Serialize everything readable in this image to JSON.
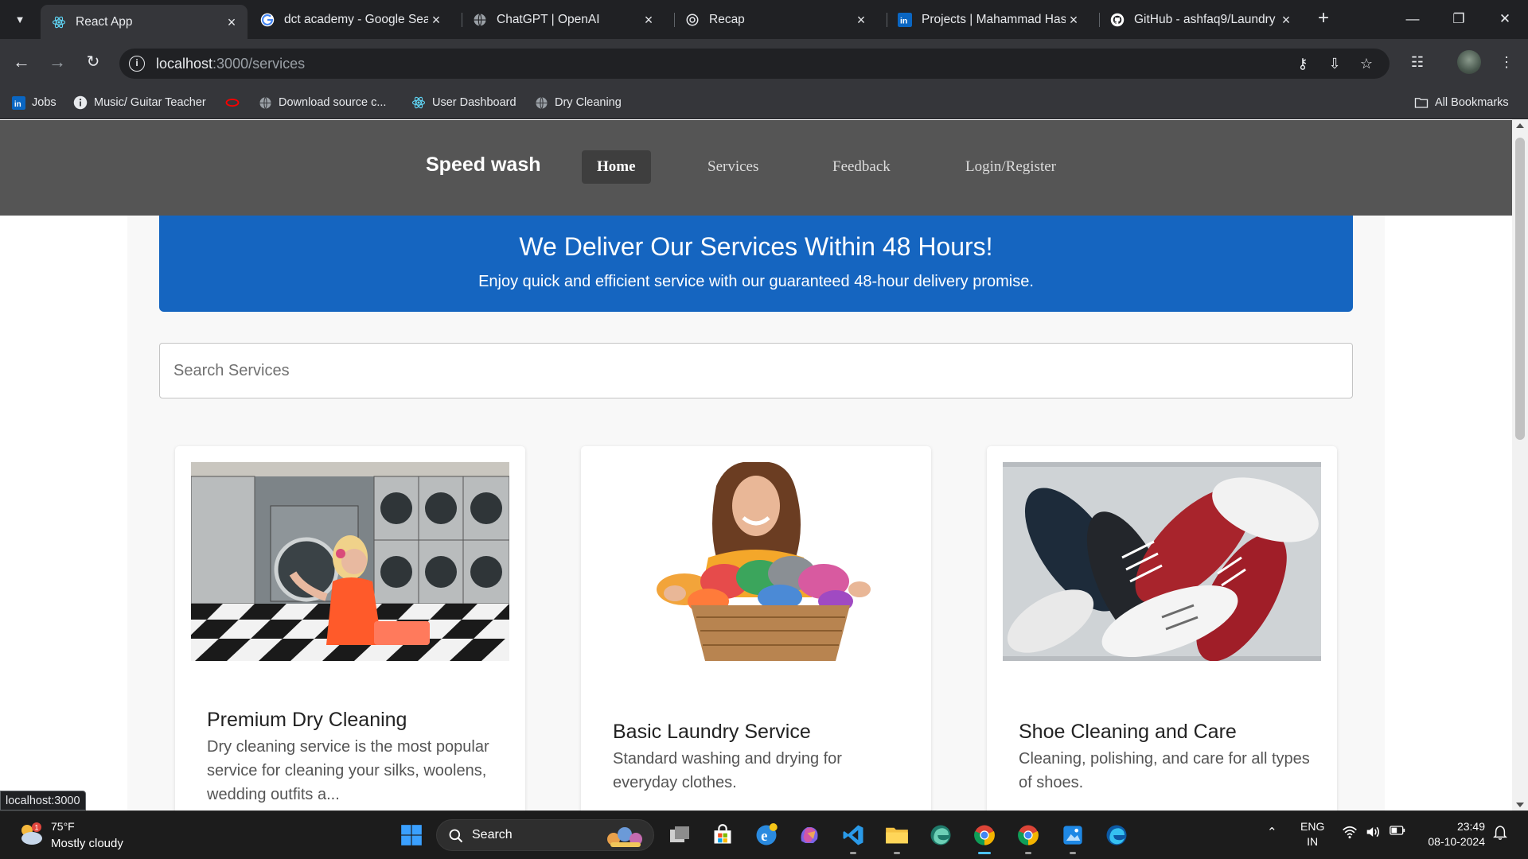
{
  "browser": {
    "tabs": [
      {
        "title": "React App",
        "icon": "react-icon",
        "active": true
      },
      {
        "title": "dct academy - Google Sea",
        "icon": "google-icon",
        "active": false
      },
      {
        "title": "ChatGPT | OpenAI",
        "icon": "globe-icon",
        "active": false
      },
      {
        "title": "Recap",
        "icon": "openai-icon",
        "active": false
      },
      {
        "title": "Projects | Mahammad Has",
        "icon": "linkedin-icon",
        "active": false
      },
      {
        "title": "GitHub - ashfaq9/Laundry",
        "icon": "github-icon",
        "active": false
      }
    ],
    "address": {
      "host": "localhost",
      "path": ":3000/services"
    },
    "bookmarks": [
      {
        "label": "Jobs",
        "icon": "linkedin-icon"
      },
      {
        "label": "Music/ Guitar Teacher",
        "icon": "info-icon"
      },
      {
        "label": "",
        "icon": "oval-icon"
      },
      {
        "label": "Download source c...",
        "icon": "globe-icon"
      },
      {
        "label": "User Dashboard",
        "icon": "react-icon"
      },
      {
        "label": "Dry Cleaning",
        "icon": "globe-icon"
      }
    ],
    "all_bookmarks": "All Bookmarks",
    "status_url": "localhost:3000"
  },
  "site": {
    "brand": "Speed wash",
    "nav": [
      {
        "label": "Home",
        "active": true
      },
      {
        "label": "Services",
        "active": false
      },
      {
        "label": "Feedback",
        "active": false
      },
      {
        "label": "Login/Register",
        "active": false
      }
    ],
    "banner": {
      "title": "We Deliver Our Services Within 48 Hours!",
      "subtitle": "Enjoy quick and efficient service with our guaranteed 48-hour delivery promise."
    },
    "search": {
      "placeholder": "Search Services",
      "value": ""
    },
    "services": [
      {
        "title": "Premium Dry Cleaning",
        "description": "Dry cleaning service is the most popular service for cleaning your silks, woolens, wedding outfits a..."
      },
      {
        "title": "Basic Laundry Service",
        "description": "Standard washing and drying for everyday clothes."
      },
      {
        "title": "Shoe Cleaning and Care",
        "description": "Cleaning, polishing, and care for all types of shoes."
      }
    ],
    "colors": {
      "nav_bg": "#555555",
      "banner_bg": "#1565c0",
      "content_bg": "#f8f8f8"
    }
  },
  "taskbar": {
    "weather": {
      "temp": "75°F",
      "desc": "Mostly cloudy",
      "badge": "1"
    },
    "search_label": "Search",
    "lang": {
      "line1": "ENG",
      "line2": "IN"
    },
    "clock": {
      "time": "23:49",
      "date": "08-10-2024"
    }
  }
}
